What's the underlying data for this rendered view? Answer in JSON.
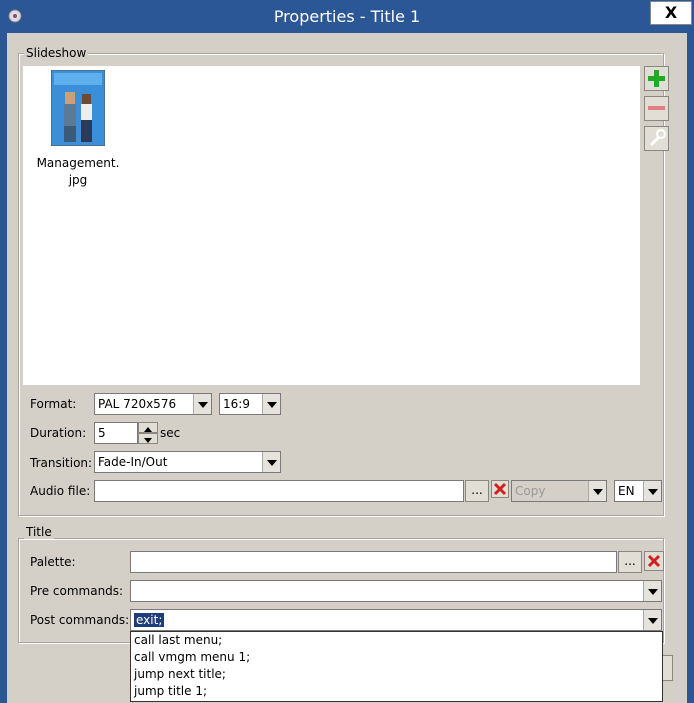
{
  "window": {
    "title": "Properties - Title 1",
    "close_label": "X"
  },
  "slideshow": {
    "legend": "Slideshow",
    "items": [
      {
        "filename_line1": "Management.",
        "filename_line2": "jpg"
      }
    ],
    "format_label": "Format:",
    "format_value": "PAL 720x576",
    "aspect_value": "16:9",
    "duration_label": "Duration:",
    "duration_value": "5",
    "duration_unit": "sec",
    "transition_label": "Transition:",
    "transition_value": "Fade-In/Out",
    "audio_label": "Audio file:",
    "audio_value": "",
    "browse_label": "...",
    "copy_value": "Copy",
    "lang_value": "EN"
  },
  "title_group": {
    "legend": "Title",
    "palette_label": "Palette:",
    "palette_value": "",
    "browse_label": "...",
    "pre_label": "Pre commands:",
    "pre_value": "",
    "post_label": "Post commands:",
    "post_value": "exit;"
  },
  "post_dropdown_options": [
    "call last menu;",
    "call vmgm menu 1;",
    "jump next title;",
    "jump title 1;"
  ],
  "colors": {
    "titlebar": "#2b5797",
    "dialog": "#d4d0c8",
    "selection": "#1c3f7c",
    "add_green": "#22aa22",
    "remove_red": "#e05050"
  }
}
